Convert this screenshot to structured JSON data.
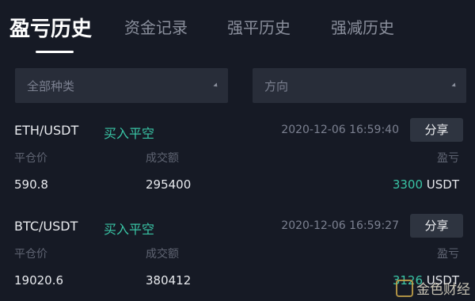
{
  "tabs": [
    {
      "label": "盈亏历史",
      "active": true
    },
    {
      "label": "资金记录",
      "active": false
    },
    {
      "label": "强平历史",
      "active": false
    },
    {
      "label": "强减历史",
      "active": false
    }
  ],
  "filters": {
    "category": "全部种类",
    "direction": "方向"
  },
  "columns": {
    "close_price": "平仓价",
    "volume": "成交额",
    "pnl": "盈亏"
  },
  "share_label": "分享",
  "records": [
    {
      "pair": "ETH/USDT",
      "side": "买入平空",
      "time": "2020-12-06 16:59:40",
      "close_price": "590.8",
      "volume": "295400",
      "pnl_value": "3300",
      "pnl_unit": "USDT"
    },
    {
      "pair": "BTC/USDT",
      "side": "买入平空",
      "time": "2020-12-06 16:59:27",
      "close_price": "19020.6",
      "volume": "380412",
      "pnl_value": "3126",
      "pnl_unit": "USDT"
    }
  ],
  "watermark": "金色财经",
  "colors": {
    "background": "#161a25",
    "accent_green": "#39c4a5",
    "filter_bg": "#282d39"
  }
}
